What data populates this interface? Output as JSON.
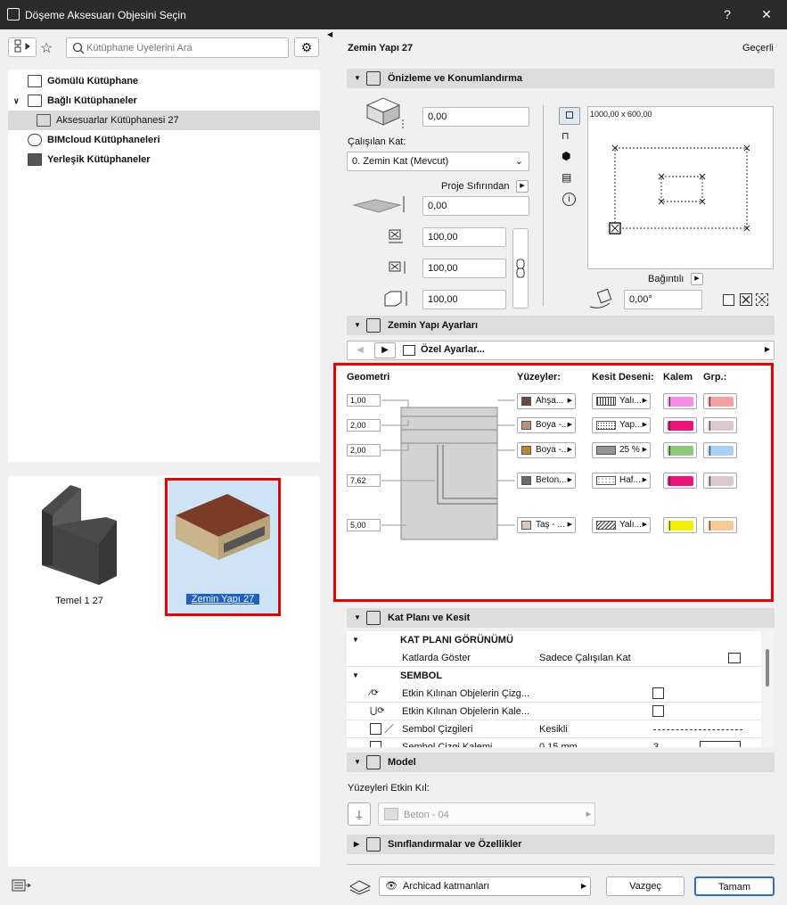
{
  "window": {
    "title": "Döşeme Aksesuarı Objesini Seçin",
    "help": "?",
    "close": "✕"
  },
  "search": {
    "placeholder": "Kütüphane Üyelerini Ara"
  },
  "tree": {
    "items": [
      {
        "label": "Gömülü Kütüphane"
      },
      {
        "label": "Bağlı Kütüphaneler"
      },
      {
        "label": "Aksesuarlar Kütüphanesi 27"
      },
      {
        "label": "BIMcloud Kütüphaneleri"
      },
      {
        "label": "Yerleşik Kütüphaneler"
      }
    ]
  },
  "thumbs": [
    {
      "label": "Temel 1 27"
    },
    {
      "label": "Zemin Yapı 27"
    }
  ],
  "panel": {
    "object_name": "Zemin Yapı 27",
    "status": "Geçerli"
  },
  "preview": {
    "header": "Önizleme ve Konumlandırma",
    "offset": "0,00",
    "story_label": "Çalışılan Kat:",
    "story_value": "0. Zemin Kat (Mevcut)",
    "reference": "Proje Sıfırından",
    "elev": "0,00",
    "x": "100,00",
    "y": "100,00",
    "z": "100,00",
    "size_label": "1000,00 x 600,00",
    "relative": "Bağıntılı",
    "angle": "0,00°"
  },
  "settings": {
    "header": "Zemin Yapı Ayarları",
    "nav_label": "Özel Ayarlar..."
  },
  "geometry": {
    "col_geo": "Geometri",
    "col_surf": "Yüzeyler:",
    "col_hatch": "Kesit Deseni:",
    "col_pen": "Kalem",
    "col_grp": "Grp.:",
    "rows": [
      {
        "thick": "1,00",
        "surf": "Ahşa...",
        "surf_color": "#6b4a3a",
        "hatch": "Yalı...",
        "pen": "#f58ee6",
        "grp": "#f5a0a0"
      },
      {
        "thick": "2,00",
        "surf": "Boya -...",
        "surf_color": "#b89470",
        "hatch": "Yap...",
        "pen": "#f0147a",
        "grp": "#dcc8c8"
      },
      {
        "thick": "2,00",
        "surf": "Boya -...",
        "surf_color": "#b8882a",
        "hatch": "25 %",
        "pen": "#90c878",
        "grp": "#a8d0f5"
      },
      {
        "thick": "7,62",
        "surf": "Beton...",
        "surf_color": "#6b6b6b",
        "hatch": "Haf...",
        "pen": "#f0147a",
        "grp": "#dcc8c8"
      },
      {
        "thick": "5,00",
        "surf": "Taş - ...",
        "surf_color": "#d8c8b8",
        "hatch": "Yalı...",
        "pen": "#f0f000",
        "grp": "#f8c898"
      }
    ]
  },
  "floorplan": {
    "header": "Kat Planı ve Kesit",
    "group1": "KAT PLANI GÖRÜNÜMÜ",
    "show_on": "Katlarda Göster",
    "show_on_val": "Sadece Çalışılan Kat",
    "group2": "SEMBOL",
    "row1": "Etkin Kılınan Objelerin Çizg...",
    "row2": "Etkin Kılınan Objelerin Kale...",
    "row3": "Sembol Çizgileri",
    "row3_val": "Kesikli",
    "row4": "Sembol Çizgi Kalemi",
    "row4_val": "0,15 mm",
    "row4_num": "3"
  },
  "model": {
    "header": "Model",
    "override_label": "Yüzeyleri Etkin Kıl:",
    "surface": "Beton - 04"
  },
  "classif": {
    "header": "Sınıflandırmalar ve Özellikler"
  },
  "footer": {
    "layer": "Archicad katmanları",
    "cancel": "Vazgeç",
    "ok": "Tamam"
  }
}
